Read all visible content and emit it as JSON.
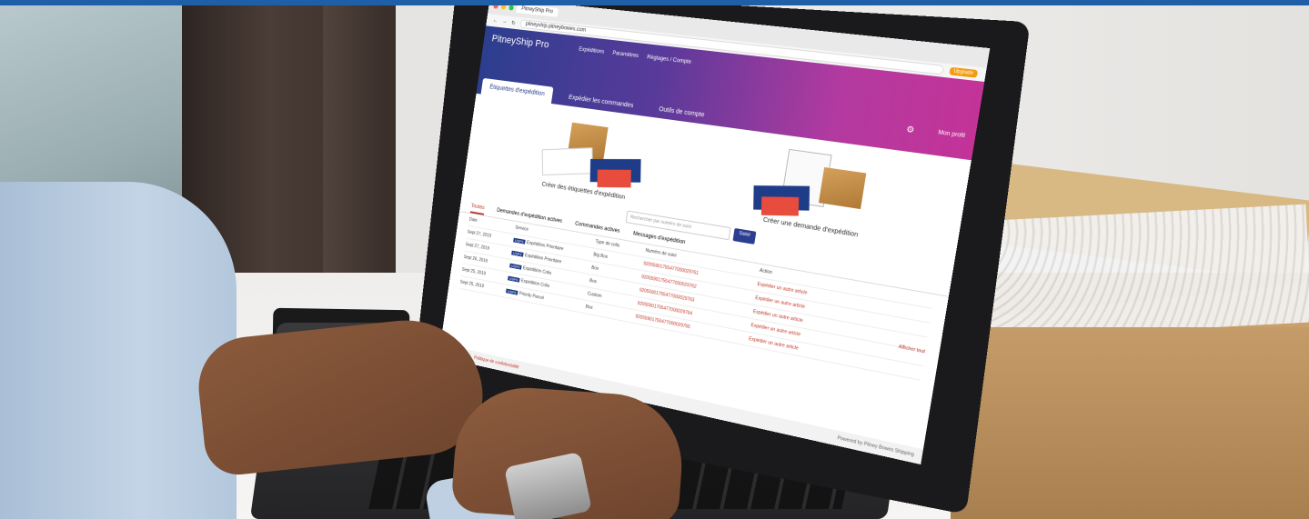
{
  "colors": {
    "accent_line": "#1f5fa8",
    "header_gradient_start": "#2c3e8f",
    "header_gradient_end": "#c33398",
    "link_red": "#c0392b"
  },
  "browser": {
    "tab_title": "PitneyShip Pro",
    "address": "pitneyship.pitneybowes.com",
    "upgrade_label": "Upgrade"
  },
  "app": {
    "logo": "PitneyShip Pro",
    "nav": [
      "Expéditions",
      "Paramètres",
      "Réglages / Compte"
    ],
    "tabs": [
      "Étiquettes d'expédition",
      "Expédier les commandes",
      "Outils de compte"
    ],
    "user_name": "Mon profil",
    "cards": [
      {
        "label": "Créer des étiquettes d'expédition"
      },
      {
        "label": "Créer une demande d'expédition"
      }
    ],
    "search_placeholder": "Rechercher par numéro de suivi",
    "search_button": "Saisir",
    "list_tabs": [
      "Toutes",
      "Demandes d'expédition actives",
      "Commandes actives",
      "Messages d'expédition"
    ],
    "table_headers": [
      "Date",
      "Service",
      "Type de colis",
      "Numéro de suivi",
      "Action"
    ],
    "rows": [
      {
        "date": "Sept 27, 2019",
        "service": "Expédition Prioritaire",
        "type": "Big Box",
        "tracking": "92055901755477000029761",
        "action": "Expédier un autre article"
      },
      {
        "date": "Sept 27, 2019",
        "service": "Expédition Prioritaire",
        "type": "Box",
        "tracking": "92055901755477000029762",
        "action": "Expédier un autre article"
      },
      {
        "date": "Sept 26, 2019",
        "service": "Expédition Colis",
        "type": "Box",
        "tracking": "92055901755477000029763",
        "action": "Expédier un autre article"
      },
      {
        "date": "Sept 25, 2019",
        "service": "Expédition Colis",
        "type": "Custom",
        "tracking": "92055901755477000029764",
        "action": "Expédier un autre article"
      },
      {
        "date": "Sept 25, 2019",
        "service": "Priority Parcel",
        "type": "Box",
        "tracking": "92055901755477000029765",
        "action": "Expédier un autre article"
      }
    ],
    "view_all": "Afficher tout",
    "footer_links": [
      "pitneybowes",
      "Politique de confidentialité"
    ],
    "footer_right": "Powered by Pitney Bowes Shipping"
  }
}
